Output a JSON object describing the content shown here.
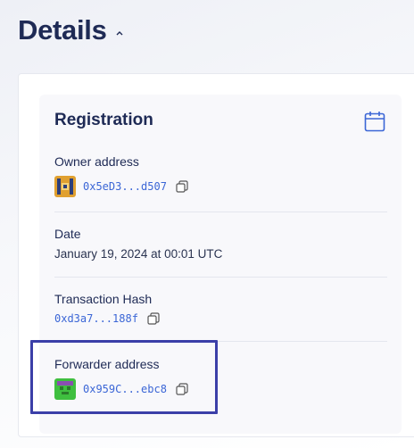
{
  "page": {
    "title": "Details"
  },
  "registration": {
    "title": "Registration",
    "owner_label": "Owner address",
    "owner_value": "0x5eD3...d507",
    "date_label": "Date",
    "date_value": "January 19, 2024 at 00:01 UTC",
    "tx_label": "Transaction Hash",
    "tx_value": "0xd3a7...188f",
    "forwarder_label": "Forwarder address",
    "forwarder_value": "0x959C...ebc8"
  },
  "colors": {
    "accent": "#3b66d6",
    "highlight": "#3b3fa8",
    "title": "#1e2a55"
  },
  "icons": {
    "collapse": "chevron-up-icon",
    "calendar": "calendar-icon",
    "copy": "copy-icon"
  }
}
